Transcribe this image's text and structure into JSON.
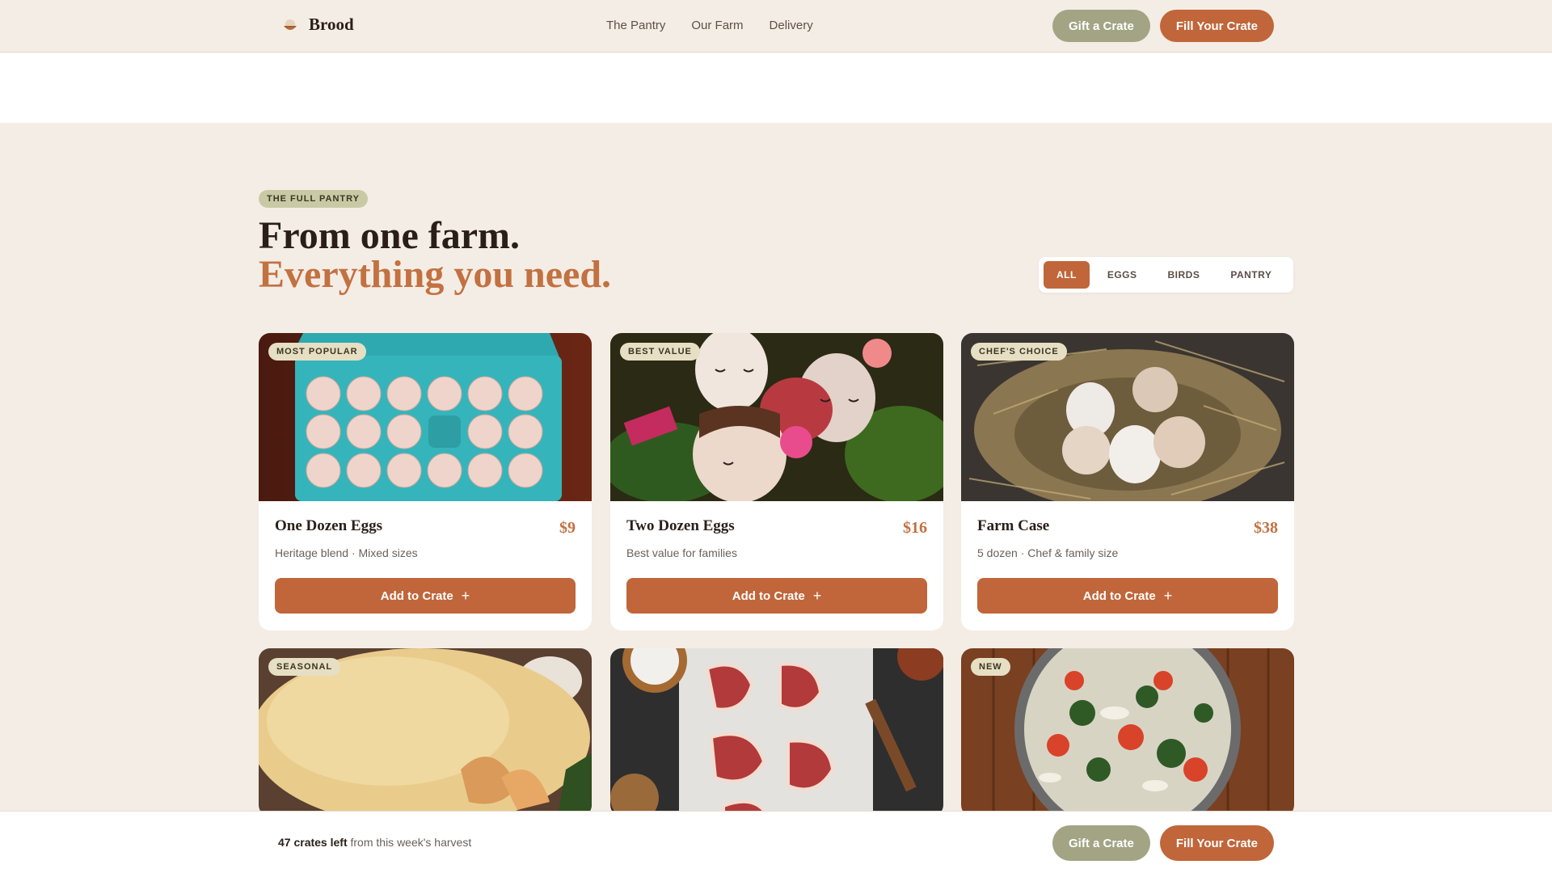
{
  "header": {
    "brand_name": "Brood",
    "nav": [
      "The Pantry",
      "Our Farm",
      "Delivery"
    ],
    "gift_label": "Gift a Crate",
    "fill_label": "Fill Your Crate"
  },
  "section": {
    "eyebrow": "THE FULL PANTRY",
    "headline_line1": "From one farm.",
    "headline_line2": "Everything you need.",
    "filters": [
      "ALL",
      "EGGS",
      "BIRDS",
      "PANTRY"
    ],
    "active_filter": "ALL"
  },
  "products": [
    {
      "badge": "MOST POPULAR",
      "title": "One Dozen Eggs",
      "price": "$9",
      "desc": "Heritage blend · Mixed sizes",
      "button": "Add to Crate",
      "image": "eggs-in-teal-carton"
    },
    {
      "badge": "BEST VALUE",
      "title": "Two Dozen Eggs",
      "price": "$16",
      "desc": "Best value for families",
      "button": "Add to Crate",
      "image": "painted-eggs"
    },
    {
      "badge": "CHEF'S CHOICE",
      "title": "Farm Case",
      "price": "$38",
      "desc": "5 dozen · Chef & family size",
      "button": "Add to Crate",
      "image": "eggs-in-nest"
    },
    {
      "badge": "SEASONAL",
      "image": "whole-roast-chicken"
    },
    {
      "badge": "",
      "image": "raw-chicken-cuts"
    },
    {
      "badge": "NEW",
      "image": "chicken-soup-pot"
    }
  ],
  "bottom_bar": {
    "stock_count": "47 crates left",
    "stock_suffix": "from this week's harvest",
    "gift_label": "Gift a Crate",
    "fill_label": "Fill Your Crate"
  },
  "colors": {
    "accent": "#c0663a",
    "olive": "#a3a484",
    "background": "#f4ede5"
  }
}
